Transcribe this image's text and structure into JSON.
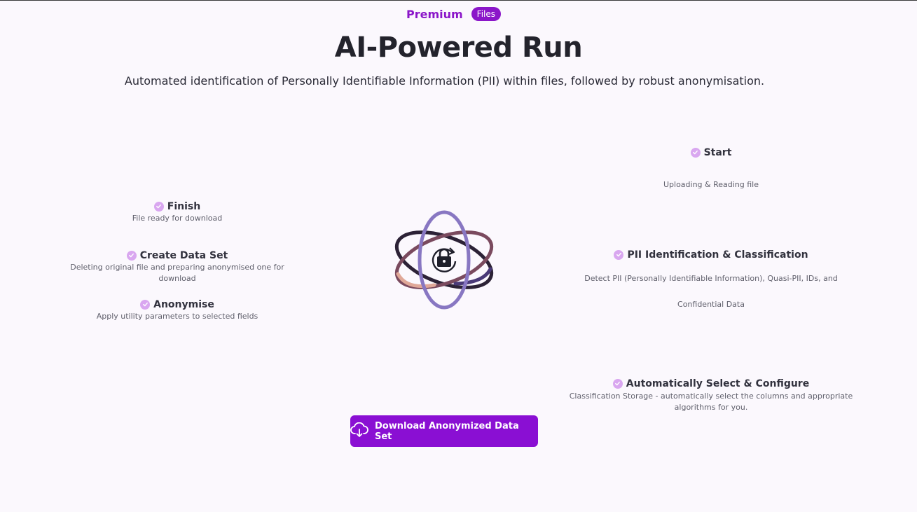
{
  "header": {
    "premium_label": "Premium",
    "files_badge": "Files"
  },
  "page": {
    "title": "AI-Powered Run",
    "subtitle": "Automated identification of Personally Identifiable Information (PII) within files, followed by robust anonymisation."
  },
  "steps_right": [
    {
      "title": "Start",
      "desc": "Uploading & Reading file"
    },
    {
      "title": "PII Identification & Classification",
      "desc_line1": "Detect PII (Personally Identifiable Information), Quasi-PII, IDs, and",
      "desc_line2": "Confidential Data"
    },
    {
      "title": "Automatically Select & Configure",
      "desc_line1": "Classification Storage - automatically select the columns and appropriate",
      "desc_line2": "algorithms for you."
    }
  ],
  "steps_left": [
    {
      "title": "Finish",
      "desc": "File ready for download"
    },
    {
      "title": "Create Data Set",
      "desc": "Deleting original file and preparing anonymised one for download"
    },
    {
      "title": "Anonymise",
      "desc": "Apply utility parameters to selected fields"
    }
  ],
  "download_button": {
    "label": "Download Anonymized Data Set",
    "icon": "cloud-download-icon"
  },
  "colors": {
    "accent": "#8a0fd3",
    "check": "#d9a7f0",
    "background": "#fbf8fd"
  }
}
